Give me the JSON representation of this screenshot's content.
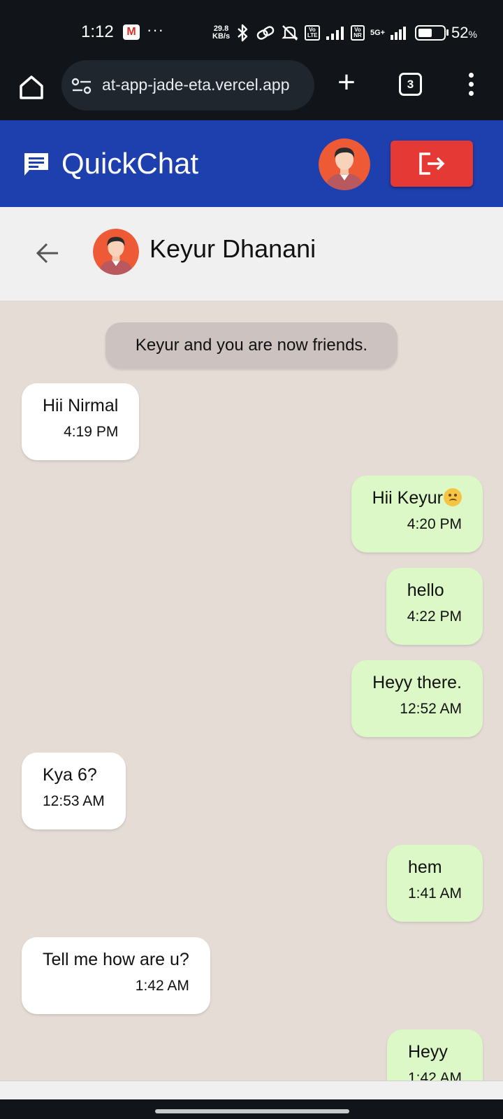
{
  "status_bar": {
    "time": "1:12",
    "gmail_glyph": "M",
    "more": "···",
    "speed_value": "29.8",
    "speed_unit": "KB/s",
    "volte_badge": "Vo LTE",
    "vonr_badge": "Vo NR",
    "network": "5G+",
    "battery_percent": "52",
    "battery_level": 0.52,
    "percent_sign": "%",
    "icons": [
      "gmail-icon",
      "bluetooth-icon",
      "link-icon",
      "mute-icon",
      "signal-icon",
      "battery-icon"
    ]
  },
  "browser": {
    "url": "at-app-jade-eta.vercel.app",
    "tab_count": "3",
    "new_tab_glyph": "+",
    "icons": [
      "home-icon",
      "site-settings-icon",
      "plus-icon",
      "tabs-icon",
      "more-vert-icon"
    ]
  },
  "app": {
    "title": "QuickChat",
    "brand_color": "#1e3fae",
    "logout_color": "#e53935",
    "icons": [
      "chat-icon",
      "avatar",
      "logout-icon"
    ]
  },
  "chat": {
    "contact_name": "Keyur Dhanani",
    "system_message": "Keyur and you are now friends.",
    "outgoing_color": "#dcf8c6",
    "incoming_color": "#ffffff",
    "messages": [
      {
        "direction": "in",
        "text": "Hii Nirmal",
        "time": "4:19 PM"
      },
      {
        "direction": "out",
        "text": "Hii Keyur",
        "emoji": "woozy-face-icon",
        "time": "4:20 PM"
      },
      {
        "direction": "out",
        "text": "hello",
        "time": "4:22 PM"
      },
      {
        "direction": "out",
        "text": "Heyy there.",
        "time": "12:52 AM"
      },
      {
        "direction": "in",
        "text": "Kya 6?",
        "time": "12:53 AM"
      },
      {
        "direction": "out",
        "text": "hem",
        "time": "1:41 AM"
      },
      {
        "direction": "in",
        "text": "Tell me how are u?",
        "time": "1:42 AM"
      },
      {
        "direction": "out",
        "text": "Heyy",
        "time": "1:42 AM"
      }
    ]
  }
}
